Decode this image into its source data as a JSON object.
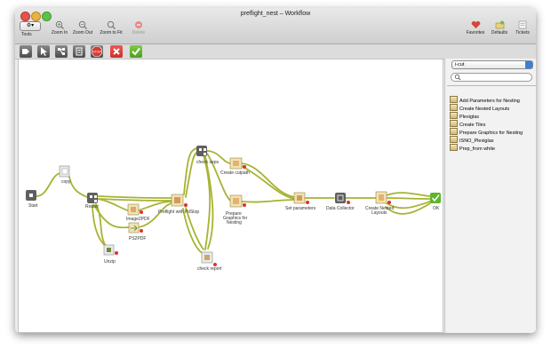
{
  "window": {
    "title": "preflight_nest – Workflow"
  },
  "toolbar": {
    "tools_label": "Tools",
    "zoom_in_label": "Zoom In",
    "zoom_out_label": "Zoom Out",
    "zoom_fit_label": "Zoom to Fit",
    "delete_label": "Delete",
    "favorites_label": "Favorites",
    "defaults_label": "Defaults",
    "tickets_label": "Tickets"
  },
  "sidebar": {
    "category": "i-cut",
    "search_placeholder": "",
    "items": [
      {
        "label": "Add Parameters for Nesting"
      },
      {
        "label": "Create Nested Layouts"
      },
      {
        "label": "Plexiglas"
      },
      {
        "label": "Create Tiles"
      },
      {
        "label": "Prepare Graphics for Nesting"
      },
      {
        "label": "ISNO_Plexiglas"
      },
      {
        "label": "Prep_from white"
      }
    ]
  },
  "workflow": {
    "nodes": [
      {
        "id": "start",
        "label": "Start"
      },
      {
        "id": "copy",
        "label": "copy"
      },
      {
        "id": "router",
        "label": "Router"
      },
      {
        "id": "unzip",
        "label": "Unzip"
      },
      {
        "id": "image2pdf",
        "label": "Image2PDF"
      },
      {
        "id": "ps2pdf",
        "label": "PS2PDF"
      },
      {
        "id": "preflight",
        "label": "Preflight with PitStop"
      },
      {
        "id": "check_seps",
        "label": "check seps"
      },
      {
        "id": "check_report",
        "label": "check report"
      },
      {
        "id": "create_cutpath",
        "label": "Create cutpath"
      },
      {
        "id": "prepare_graphics",
        "label": "Prepare Graphics for Nesting"
      },
      {
        "id": "set_parameters",
        "label": "Set parameters"
      },
      {
        "id": "data_collector",
        "label": "Data Collector"
      },
      {
        "id": "create_nested",
        "label": "Create Nested Layouts"
      },
      {
        "id": "ok",
        "label": "OK"
      }
    ]
  },
  "colors": {
    "connection": "#a7b332",
    "error_dot": "#e0302b",
    "ok_green": "#5fb42b",
    "stop_red": "#e0302b"
  }
}
